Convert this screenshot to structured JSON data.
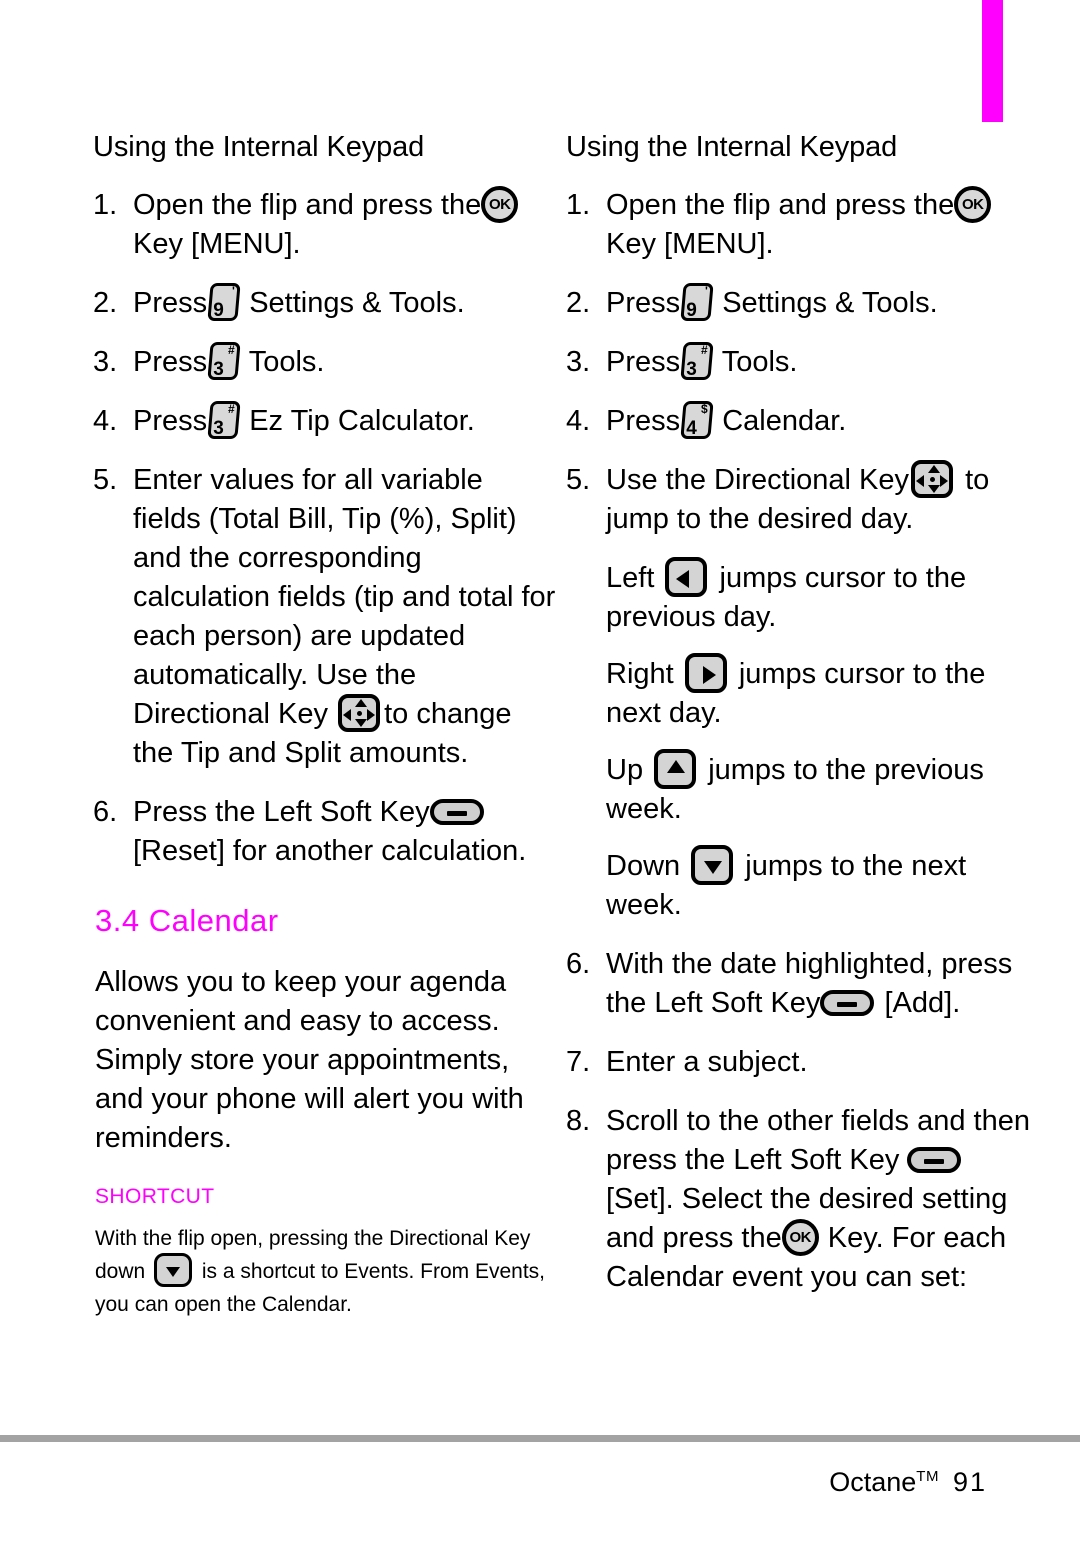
{
  "page": {
    "footer_brand": "Octane",
    "footer_trademark": "TM",
    "footer_page_number": "91",
    "tab_color": "#ff00ff",
    "accent_color": "#ff00ff",
    "rule_color": "#a3a3a3"
  },
  "left_column": {
    "title": "Using the Internal Keypad",
    "steps": [
      {
        "num": "1.",
        "text_before": "Open the flip and press the",
        "icon": "ok-key-icon",
        "icon_label": "OK",
        "text_after": "Key [MENU]."
      },
      {
        "num": "2.",
        "text_before": "Press",
        "icon": "number-key-9-icon",
        "key_digit": "9",
        "key_super": "'",
        "text_after": "Settings & Tools."
      },
      {
        "num": "3.",
        "text_before": "Press",
        "icon": "number-key-3-icon",
        "key_digit": "3",
        "key_super": "#",
        "text_after": "Tools."
      },
      {
        "num": "4.",
        "text_before": "Press",
        "icon": "number-key-3-icon",
        "key_digit": "3",
        "key_super": "#",
        "text_after": "Ez Tip Calculator."
      },
      {
        "num": "5.",
        "text_before": "Enter values for all variable fields (Total Bill, Tip (%), Split) and the corresponding calculation fields (tip and total for each person) are updated automatically. Use the Directional Key",
        "icon": "directional-key-icon",
        "text_after": "to change the Tip and Split amounts."
      },
      {
        "num": "6.",
        "text_before": "Press the Left Soft Key",
        "icon": "left-soft-key-icon",
        "text_after": "[Reset] for another calculation."
      }
    ],
    "section": {
      "number": "3.4",
      "heading": "Calendar",
      "body": "Allows you to keep your agenda convenient and easy to access. Simply store your appointments, and your phone will alert you with reminders.",
      "shortcut_label": "SHORTCUT",
      "shortcut_text_before": "With the flip open, pressing the Directional Key down",
      "shortcut_icon": "arrow-down-key-icon",
      "shortcut_text_after": "is a shortcut to Events. From Events, you can open the Calendar."
    }
  },
  "right_column": {
    "title": "Using the Internal Keypad",
    "steps": [
      {
        "num": "1.",
        "text_before": "Open the flip and press the",
        "icon": "ok-key-icon",
        "icon_label": "OK",
        "text_after": "Key [MENU]."
      },
      {
        "num": "2.",
        "text_before": "Press",
        "icon": "number-key-9-icon",
        "key_digit": "9",
        "key_super": "'",
        "text_after": "Settings & Tools."
      },
      {
        "num": "3.",
        "text_before": "Press",
        "icon": "number-key-3-icon",
        "key_digit": "3",
        "key_super": "#",
        "text_after": "Tools."
      },
      {
        "num": "4.",
        "text_before": "Press",
        "icon": "number-key-4-icon",
        "key_digit": "4",
        "key_super": "$",
        "text_after": "Calendar."
      },
      {
        "num": "5.",
        "text_before": "Use the Directional Key",
        "icon": "directional-key-icon",
        "text_after": "to jump to the desired day."
      },
      {
        "num": "6.",
        "text_before": "With the date highlighted, press the Left Soft Key",
        "icon": "left-soft-key-icon",
        "text_after": "[Add]."
      },
      {
        "num": "7.",
        "text_before": "Enter a subject.",
        "icon": "",
        "text_after": ""
      },
      {
        "num": "8.",
        "text_before": "Scroll to the other fields and then press the Left Soft Key",
        "icon": "left-soft-key-icon",
        "text_mid": "[Set]. Select the desired setting and press the",
        "icon2": "ok-key-icon",
        "icon2_label": "OK",
        "text_after": "Key. For each Calendar event you can set:"
      }
    ],
    "direction_notes": [
      {
        "label": "Left",
        "icon": "arrow-left-key-icon",
        "text": "jumps cursor to the previous day."
      },
      {
        "label": "Right",
        "icon": "arrow-right-key-icon",
        "text": "jumps cursor to the next day."
      },
      {
        "label": "Up",
        "icon": "arrow-up-key-icon",
        "text": "jumps to the previous week."
      },
      {
        "label": "Down",
        "icon": "arrow-down-key-icon",
        "text": "jumps to the next week."
      }
    ]
  }
}
